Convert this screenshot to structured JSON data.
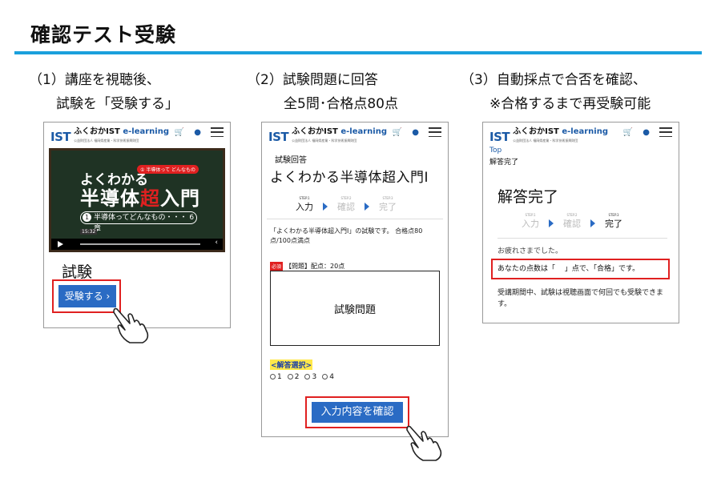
{
  "page": {
    "title": "確認テスト受験",
    "accent_color": "#1aa0dc"
  },
  "steps": [
    {
      "line1": "（1）講座を視聴後、",
      "line2": "試験を「受験する」"
    },
    {
      "line1": "（2）試験問題に回答",
      "line2": "全5問･合格点80点"
    },
    {
      "line1": "（3）自動採点で合否を確認、",
      "line2": "※合格するまで再受験可能"
    }
  ],
  "app_header": {
    "logo_mark": "IST",
    "logo_name": "ふくおかIST",
    "logo_suffix": "e-learning",
    "logo_sub": "公益財団法人 福岡県産業・科学技術振興財団",
    "cart_icon": "cart-icon",
    "user_icon": "user-icon",
    "menu_icon": "hamburger-menu-icon"
  },
  "phone1": {
    "video_line1": "よくわかる",
    "video_line2a": "半導体",
    "video_line2b": "超",
    "video_line2c": "入門",
    "video_badge": "① 半導体って どんなもの",
    "chapter_num": "1",
    "chapter_text": "半導体ってどんなもの・・・ 6章",
    "video_time": "15:32",
    "heading": "試験",
    "take_button": "受験する ›"
  },
  "phone2": {
    "crumb": "試験回答",
    "title": "よくわかる半導体超入門I",
    "stepper": [
      {
        "step": "STEP.1",
        "label": "入力"
      },
      {
        "step": "STEP.2",
        "label": "確認"
      },
      {
        "step": "STEP.3",
        "label": "完了"
      }
    ],
    "description": "「よくわかる半導体超入門I」の試験です。 合格点80点/100点満点",
    "required_badge": "必須",
    "question_label": "【問題】配点：20点",
    "question_box": "試験問題",
    "answer_label": "<解答選択>",
    "options": [
      "1",
      "2",
      "3",
      "4"
    ],
    "confirm_button": "入力内容を確認"
  },
  "phone3": {
    "crumb_top": "Top",
    "crumb": "解答完了",
    "title": "解答完了",
    "stepper": [
      {
        "step": "STEP.1",
        "label": "入力"
      },
      {
        "step": "STEP.2",
        "label": "確認"
      },
      {
        "step": "STEP.3",
        "label": "完了"
      }
    ],
    "thanks": "お疲れさまでした。",
    "score_text": "あなたの点数は「　 」点で、「合格」です。",
    "note": "受講期間中、試験は視聴画面で何回でも受験できます。"
  }
}
